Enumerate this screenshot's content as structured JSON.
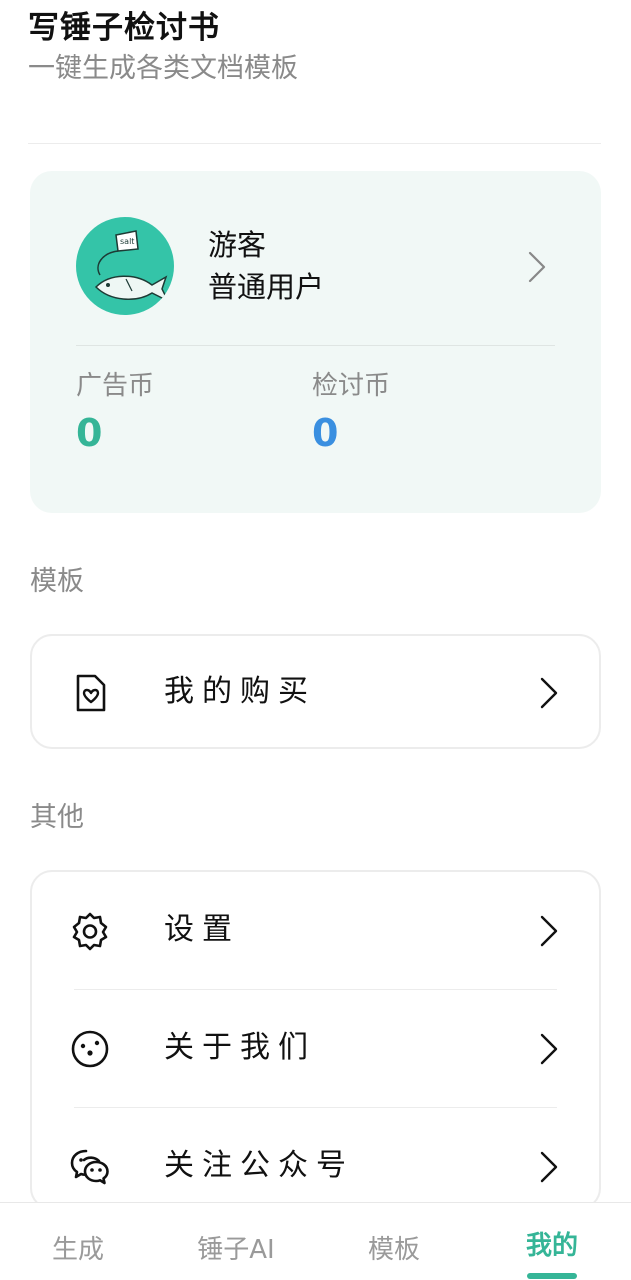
{
  "header": {
    "title": "写锤子检讨书",
    "subtitle": "一键生成各类文档模板"
  },
  "profile": {
    "name": "游客",
    "level": "普通用户",
    "avatar_icon": "salt-fish-avatar",
    "stats": [
      {
        "label": "广告币",
        "value": "0",
        "color": "#35b597"
      },
      {
        "label": "检讨币",
        "value": "0",
        "color": "#3a8fe0"
      }
    ]
  },
  "sections": {
    "templates": {
      "title": "模板",
      "items": [
        {
          "label": "我的购买",
          "icon": "purchase-icon"
        }
      ]
    },
    "other": {
      "title": "其他",
      "items": [
        {
          "label": "设置",
          "icon": "gear-icon"
        },
        {
          "label": "关于我们",
          "icon": "about-icon"
        },
        {
          "label": "关注公众号",
          "icon": "wechat-icon"
        }
      ]
    }
  },
  "bottom_nav": {
    "items": [
      {
        "label": "生成",
        "active": false
      },
      {
        "label": "锤子AI",
        "active": false
      },
      {
        "label": "模板",
        "active": false
      },
      {
        "label": "我的",
        "active": true
      }
    ],
    "accent": "#35b597"
  }
}
